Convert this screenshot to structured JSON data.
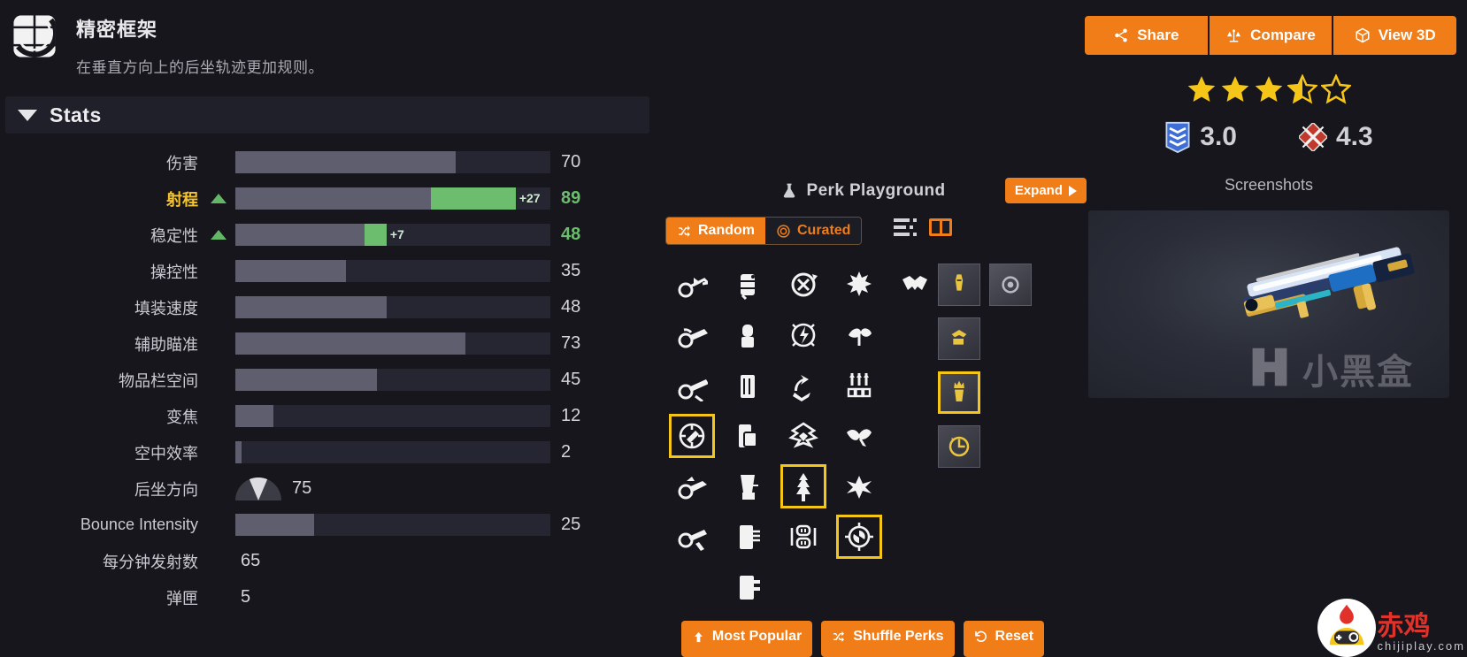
{
  "frame": {
    "icon": "precision-frame-icon",
    "title": "精密框架",
    "description": "在垂直方向上的后坐轨迹更加规则。"
  },
  "stats_panel": {
    "header_label": "Stats",
    "caret_icon": "chevron-down-icon",
    "rows": [
      {
        "label": "伤害",
        "value": "70",
        "bar": 70,
        "bonus": 0,
        "bonus_label": "",
        "highlight": false,
        "type": "bar"
      },
      {
        "label": "射程",
        "value": "89",
        "bar": 62,
        "bonus": 27,
        "bonus_label": "+27",
        "highlight": true,
        "type": "bar"
      },
      {
        "label": "稳定性",
        "value": "48",
        "bar": 41,
        "bonus": 7,
        "bonus_label": "+7",
        "highlight": false,
        "type": "bar"
      },
      {
        "label": "操控性",
        "value": "35",
        "bar": 35,
        "bonus": 0,
        "bonus_label": "",
        "highlight": false,
        "type": "bar"
      },
      {
        "label": "填装速度",
        "value": "48",
        "bar": 48,
        "bonus": 0,
        "bonus_label": "",
        "highlight": false,
        "type": "bar"
      },
      {
        "label": "辅助瞄准",
        "value": "73",
        "bar": 73,
        "bonus": 0,
        "bonus_label": "",
        "highlight": false,
        "type": "bar"
      },
      {
        "label": "物品栏空间",
        "value": "45",
        "bar": 45,
        "bonus": 0,
        "bonus_label": "",
        "highlight": false,
        "type": "bar"
      },
      {
        "label": "变焦",
        "value": "12",
        "bar": 12,
        "bonus": 0,
        "bonus_label": "",
        "highlight": false,
        "type": "bar"
      },
      {
        "label": "空中效率",
        "value": "2",
        "bar": 2,
        "bonus": 0,
        "bonus_label": "",
        "highlight": false,
        "type": "bar"
      },
      {
        "label": "后坐方向",
        "value": "75",
        "bar": 0,
        "bonus": 0,
        "bonus_label": "",
        "highlight": false,
        "type": "dial"
      },
      {
        "label": "Bounce Intensity",
        "value": "25",
        "bar": 25,
        "bonus": 0,
        "bonus_label": "",
        "highlight": false,
        "type": "bar"
      },
      {
        "label": "每分钟发射数",
        "value": "65",
        "bar": 0,
        "bonus": 0,
        "bonus_label": "",
        "highlight": false,
        "type": "plain"
      },
      {
        "label": "弹匣",
        "value": "5",
        "bar": 0,
        "bonus": 0,
        "bonus_label": "",
        "highlight": false,
        "type": "plain"
      }
    ]
  },
  "perk_playground": {
    "title": "Perk Playground",
    "flask_icon": "flask-icon",
    "expand_label": "Expand",
    "expand_icon": "chevron-right-icon",
    "mode_random": "Random",
    "mode_random_icon": "shuffle-icon",
    "mode_curated": "Curated",
    "mode_curated_icon": "target-icon",
    "view_list_icon": "list-view-icon",
    "view_grid_icon": "grid-view-icon",
    "perk_columns": [
      {
        "name": "barrels",
        "perks": [
          {
            "icon": "arrowhead-brake-icon",
            "selected": false
          },
          {
            "icon": "corkscrew-rifling-icon",
            "selected": false
          },
          {
            "icon": "extended-barrel-icon",
            "selected": false
          },
          {
            "icon": "fluted-barrel-icon",
            "selected": true
          },
          {
            "icon": "full-bore-icon",
            "selected": false
          },
          {
            "icon": "hammer-forged-icon",
            "selected": false
          }
        ]
      },
      {
        "name": "magazines",
        "perks": [
          {
            "icon": "accurized-rounds-icon",
            "selected": false
          },
          {
            "icon": "alloy-magazine-icon",
            "selected": false
          },
          {
            "icon": "appended-mag-icon",
            "selected": false
          },
          {
            "icon": "extended-mag-icon",
            "selected": false
          },
          {
            "icon": "flared-magwell-icon",
            "selected": false
          },
          {
            "icon": "light-mag-icon",
            "selected": false
          },
          {
            "icon": "tactical-mag-icon",
            "selected": false
          }
        ]
      },
      {
        "name": "trait-column-1",
        "perks": [
          {
            "icon": "disruption-break-icon",
            "selected": false
          },
          {
            "icon": "explosive-payload-icon",
            "selected": false
          },
          {
            "icon": "quickdraw-icon",
            "selected": false
          },
          {
            "icon": "rampage-icon",
            "selected": false
          },
          {
            "icon": "tree-perk-icon",
            "selected": true
          },
          {
            "icon": "dual-loader-icon",
            "selected": false
          }
        ]
      },
      {
        "name": "trait-column-2",
        "perks": [
          {
            "icon": "firefly-icon",
            "selected": false
          },
          {
            "icon": "dragonfly-icon",
            "selected": false
          },
          {
            "icon": "triple-tap-icon",
            "selected": false
          },
          {
            "icon": "vorpal-icon",
            "selected": false
          },
          {
            "icon": "shatter-burst-icon",
            "selected": false
          },
          {
            "icon": "turnabout-icon",
            "selected": true
          }
        ]
      },
      {
        "name": "origin-traits",
        "perks": [
          {
            "icon": "handshake-origin-icon",
            "selected": false
          }
        ]
      }
    ],
    "mods": [
      {
        "icon": "boss-spec-mod-icon",
        "selected": false
      },
      {
        "icon": "backup-mag-mod-icon",
        "selected": false
      },
      {
        "icon": "major-spec-mod-icon",
        "selected": true
      },
      {
        "icon": "counterbalance-mod-icon",
        "selected": false
      }
    ],
    "masterwork": {
      "icon": "masterwork-icon",
      "selected": false
    },
    "footer_buttons": [
      {
        "label": "Most Popular",
        "icon": "arrow-up-icon"
      },
      {
        "label": "Shuffle Perks",
        "icon": "shuffle-icon"
      },
      {
        "label": "Reset",
        "icon": "reset-icon"
      }
    ]
  },
  "right_panel": {
    "actions": [
      {
        "label": "Share",
        "icon": "share-icon"
      },
      {
        "label": "Compare",
        "icon": "scales-icon"
      },
      {
        "label": "View 3D",
        "icon": "cube-icon"
      }
    ],
    "rating": {
      "stars_filled": 3,
      "stars_half": 1,
      "stars_empty": 1,
      "max": 5
    },
    "scores": [
      {
        "icon": "chevron-badge-icon",
        "value": "3.0",
        "color": "#3d6fd6"
      },
      {
        "icon": "crossed-blades-icon",
        "value": "4.3",
        "color": "#c0392b"
      }
    ],
    "screenshots_label": "Screenshots",
    "watermark": {
      "cn": "小黑盒",
      "brand_cn": "赤鸡",
      "brand_en": "chijiplay.com"
    }
  },
  "colors": {
    "accent_orange": "#f07d18",
    "select_yellow": "#f5c518",
    "bonus_green": "#6cbd6e",
    "highlight_yellow": "#f4c430",
    "bg": "#16161c",
    "panel": "#20202a",
    "bar_track": "#262633",
    "bar_fill": "#5e5e6e"
  }
}
